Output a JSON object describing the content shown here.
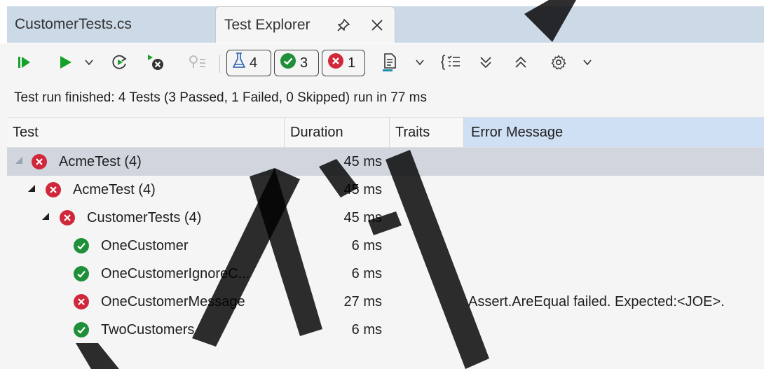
{
  "tabs": [
    {
      "label": "CustomerTests.cs",
      "active": false
    },
    {
      "label": "Test Explorer",
      "active": true
    }
  ],
  "toolbar": {
    "counters": {
      "total": "4",
      "passed": "3",
      "failed": "1"
    }
  },
  "status": {
    "text": "Test run finished: 4 Tests (3 Passed, 1 Failed, 0 Skipped) run in 77 ms"
  },
  "columns": {
    "test": "Test",
    "duration": "Duration",
    "traits": "Traits",
    "error": "Error Message"
  },
  "rows": [
    {
      "name": "AcmeTest  (4)",
      "duration": "45 ms",
      "error": "",
      "status": "failed",
      "level": 0
    },
    {
      "name": "AcmeTest  (4)",
      "duration": "45 ms",
      "error": "",
      "status": "failed",
      "level": 1
    },
    {
      "name": "CustomerTests  (4)",
      "duration": "45 ms",
      "error": "",
      "status": "failed",
      "level": 2
    },
    {
      "name": "OneCustomer",
      "duration": "6 ms",
      "error": "",
      "status": "passed",
      "level": 3
    },
    {
      "name": "OneCustomerIgnoreC...",
      "duration": "6 ms",
      "error": "",
      "status": "passed",
      "level": 3
    },
    {
      "name": "OneCustomerMessage",
      "duration": "27 ms",
      "error": "Assert.AreEqual failed. Expected:<JOE>.",
      "status": "failed",
      "level": 3
    },
    {
      "name": "TwoCustomers",
      "duration": "6 ms",
      "error": "",
      "status": "passed",
      "level": 3
    }
  ],
  "colors": {
    "passed": "#1f8f3a",
    "failed": "#d0283a",
    "run_green": "#16a02a",
    "tab_band": "#ccd9e6",
    "selected_row": "#d0d5de",
    "header_highlight": "#cfe0f4"
  },
  "icons": {
    "pin": "pin-icon",
    "close": "close-icon",
    "run_all": "run-all-icon",
    "run": "run-icon",
    "dropdown": "chevron-down-icon",
    "repeat": "repeat-run-icon",
    "cancel": "cancel-run-icon",
    "debug": "debug-icon",
    "flask": "flask-icon",
    "playlist": "playlist-icon",
    "group": "group-by-icon",
    "expand": "expand-all-icon",
    "collapse": "collapse-all-icon",
    "settings": "gear-icon"
  }
}
